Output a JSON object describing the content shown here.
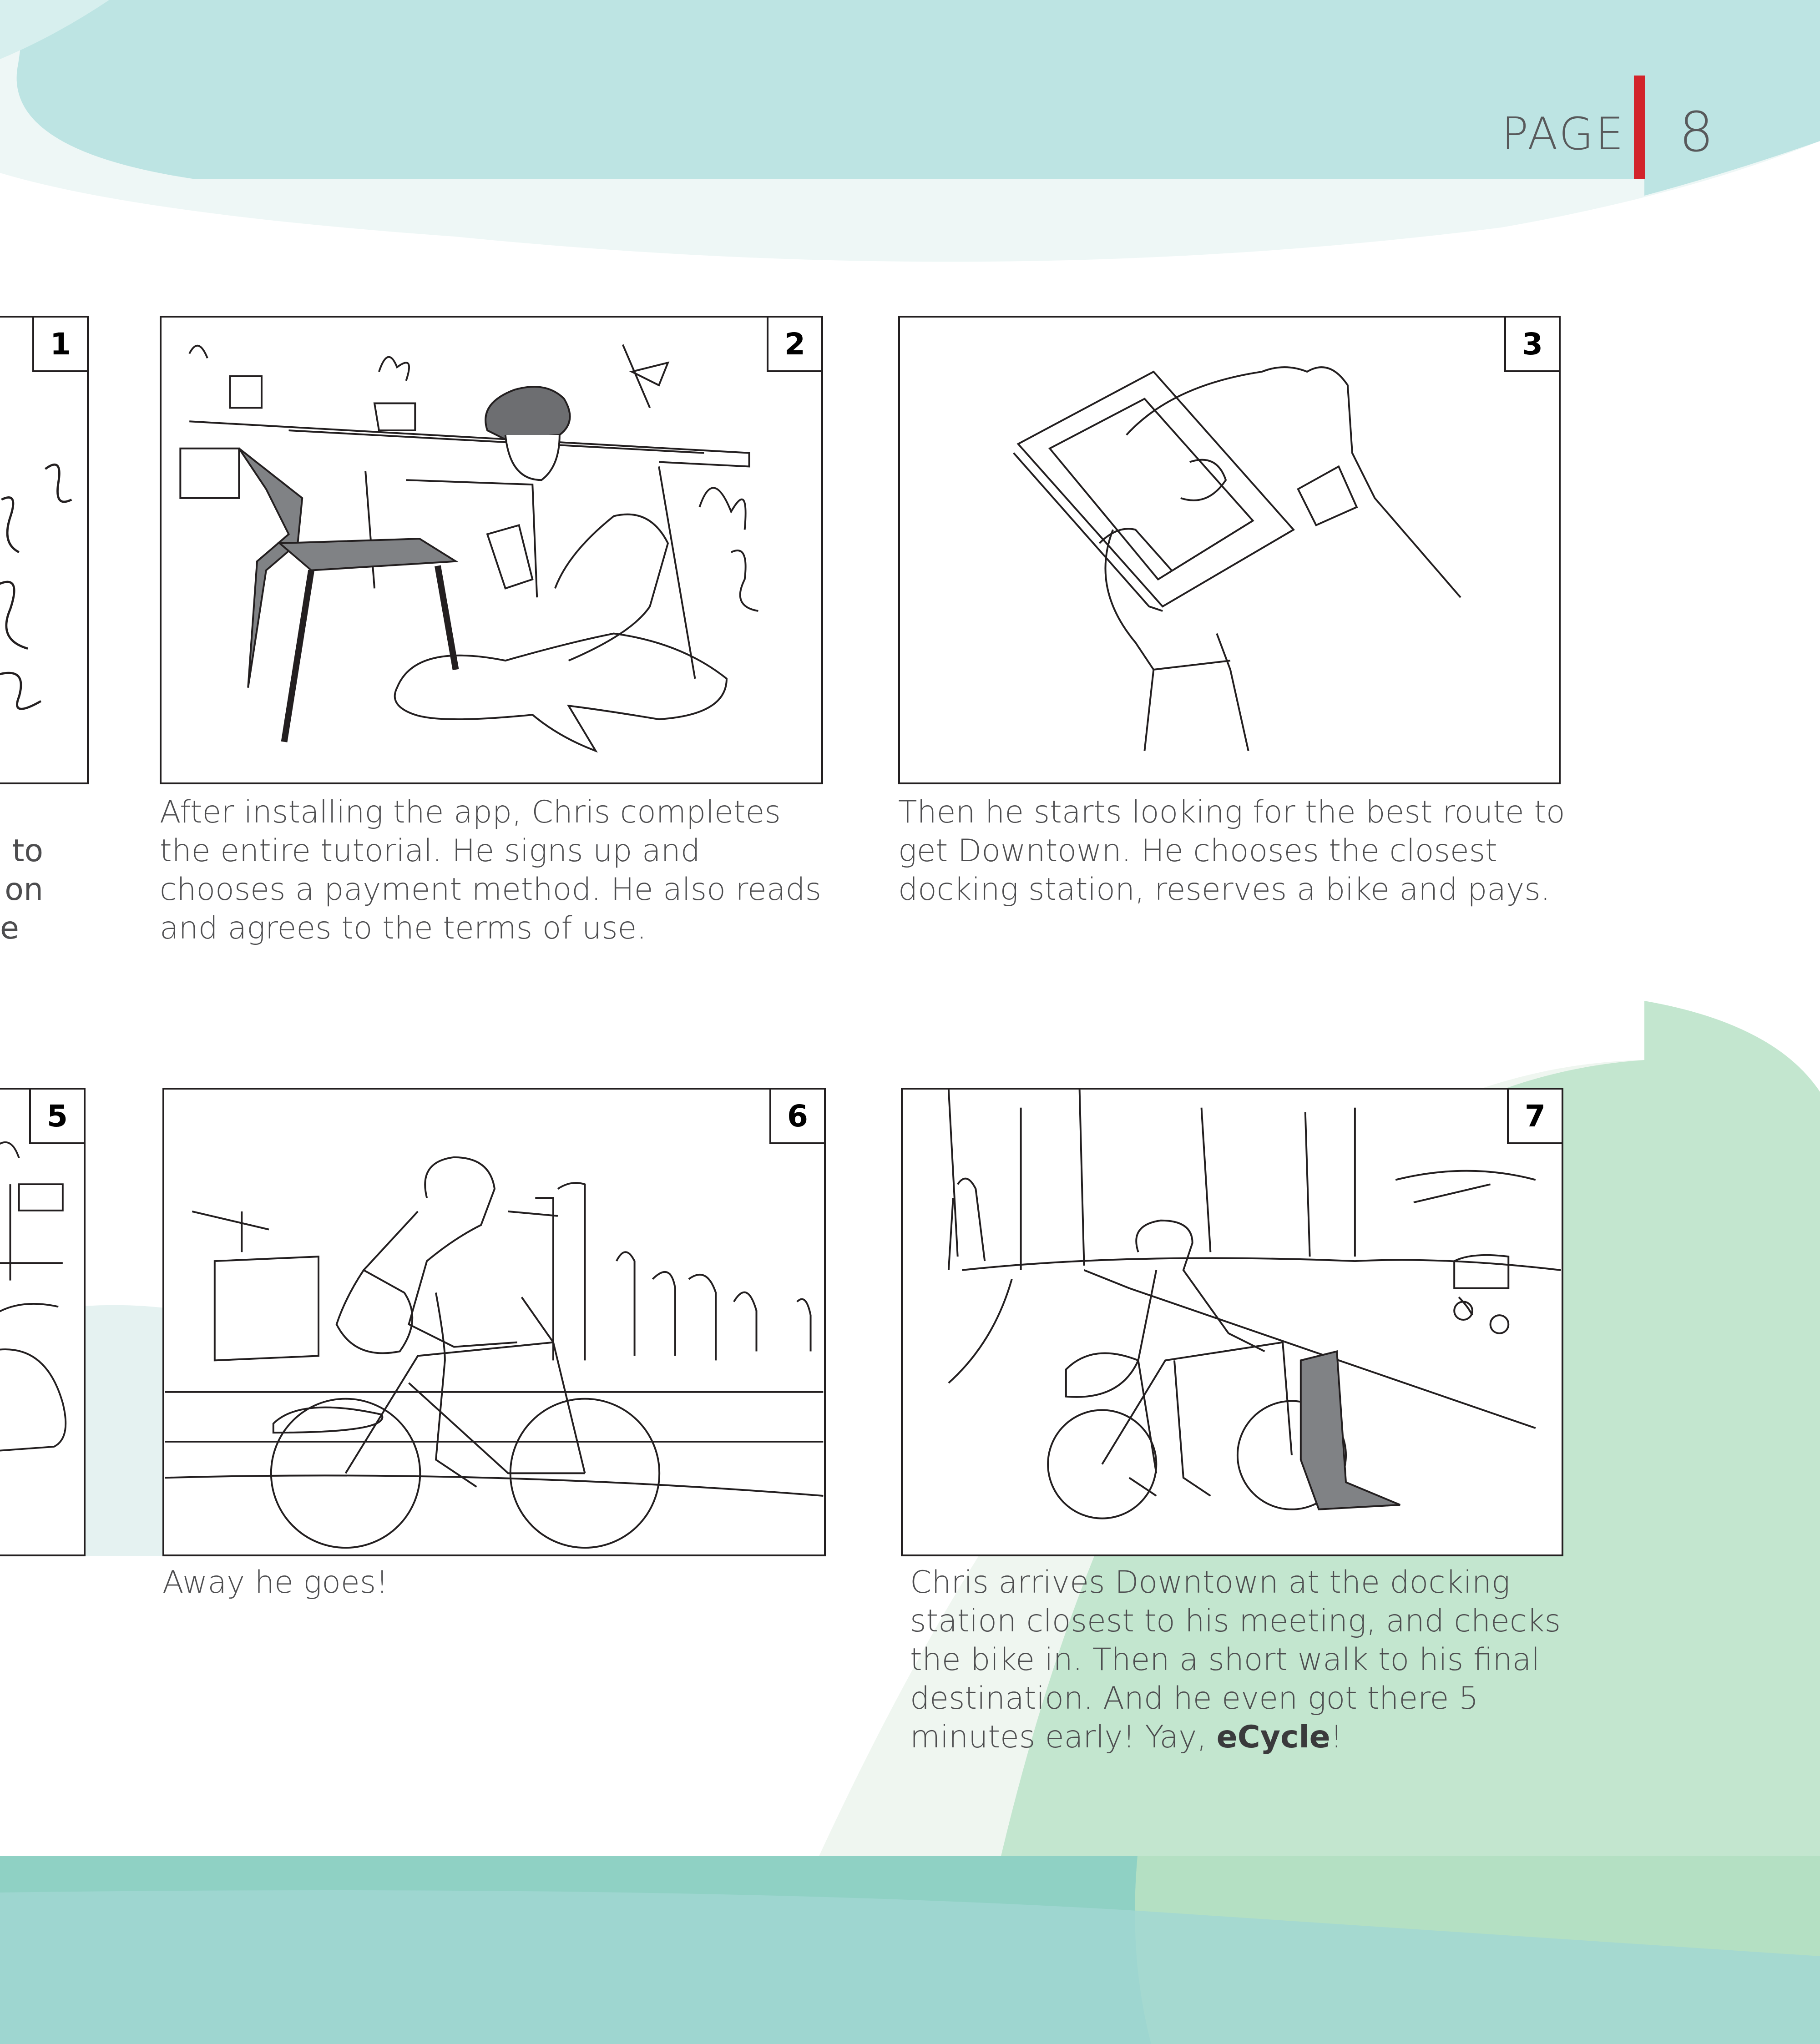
{
  "header": {
    "page_label": "PAGE",
    "page_number": "8",
    "accent_color": "#d2232a"
  },
  "colors": {
    "teal_light": "#bde4e3",
    "teal_pale": "#eef7f6",
    "green": "#c3e6cf",
    "teal_mid": "#8fd1c4"
  },
  "panels": [
    {
      "number": "1",
      "caption_fragments": [
        "n to",
        "ns on",
        "e"
      ]
    },
    {
      "number": "2",
      "caption": "After installing the app, Chris completes the entire tutorial. He signs up and chooses a payment method. He also reads and agrees to the terms of use."
    },
    {
      "number": "3",
      "caption": "Then he starts looking for the best route to get Downtown. He chooses the closest docking station, reserves a bike and pays."
    },
    {
      "number": "5"
    },
    {
      "number": "6",
      "caption": "Away he goes!"
    },
    {
      "number": "7",
      "caption": "Chris arrives Downtown at the docking station closest to his meeting, and checks the bike in. Then a short walk to his final destination. And he even got there 5 minutes early! Yay, ",
      "caption_brand": "eCycle",
      "caption_end": "!"
    }
  ]
}
